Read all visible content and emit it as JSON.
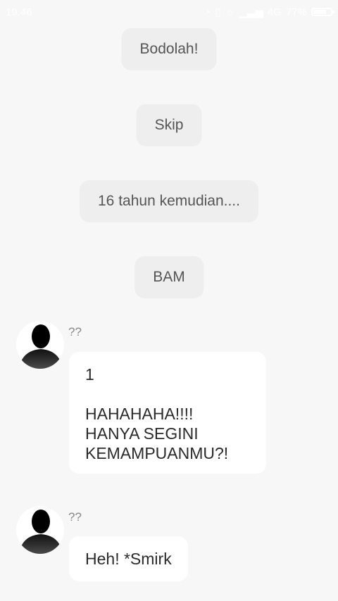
{
  "status_bar": {
    "time": "19.46",
    "network": "4G",
    "battery_percent": "77%",
    "battery_level": 0.77
  },
  "narrations": [
    "Bodolah!",
    "Skip",
    "16 tahun kemudian....",
    "BAM"
  ],
  "messages": [
    {
      "sender": "??",
      "lines": [
        "1",
        "",
        "HAHAHAHA!!!!",
        "HANYA SEGINI",
        "KEMAMPUANMU?!"
      ]
    },
    {
      "sender": "??",
      "lines": [
        "Heh! *Smirk"
      ]
    }
  ]
}
